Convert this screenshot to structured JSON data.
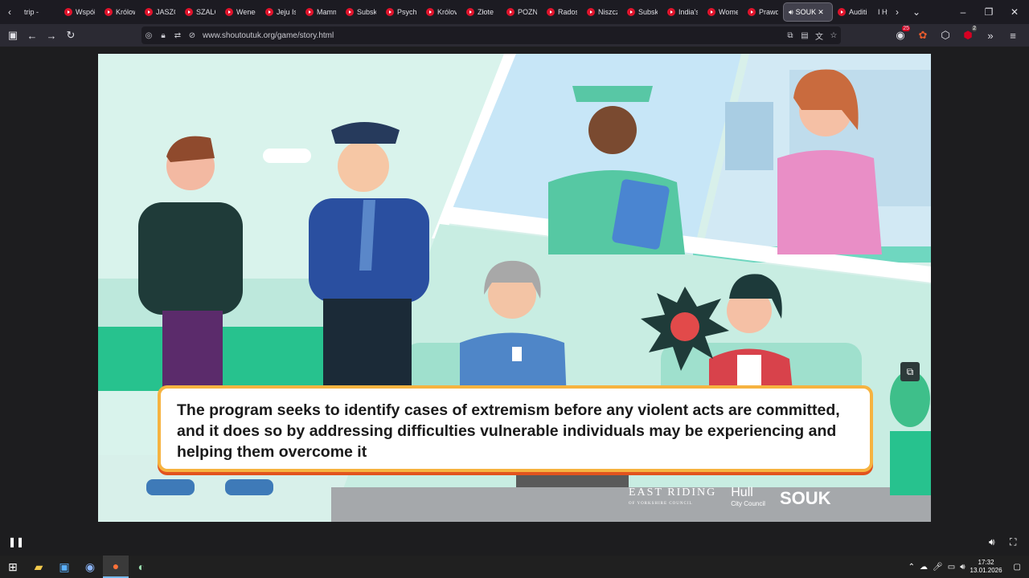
{
  "browser": {
    "tabs": [
      {
        "label": "trip - ",
        "fav": false
      },
      {
        "label": "Współ",
        "fav": true
      },
      {
        "label": "Królow",
        "fav": true
      },
      {
        "label": "JASZC",
        "fav": true
      },
      {
        "label": "SZALC",
        "fav": true
      },
      {
        "label": "Wenec",
        "fav": true
      },
      {
        "label": "Jeju Is",
        "fav": true
      },
      {
        "label": "Mamm",
        "fav": true
      },
      {
        "label": "Subsk",
        "fav": true
      },
      {
        "label": "Psych",
        "fav": true
      },
      {
        "label": "Królov",
        "fav": true
      },
      {
        "label": "Złote",
        "fav": true
      },
      {
        "label": "POZN",
        "fav": true
      },
      {
        "label": "Rados",
        "fav": true
      },
      {
        "label": "Niszcz",
        "fav": true
      },
      {
        "label": "Subsk",
        "fav": true
      },
      {
        "label": "India's",
        "fav": true
      },
      {
        "label": "Wome",
        "fav": true
      },
      {
        "label": "Prawd",
        "fav": true
      },
      {
        "label": "SOUK",
        "fav": false,
        "active": true
      },
      {
        "label": "Auditi",
        "fav": true
      },
      {
        "label": "I Hy",
        "fav": false
      }
    ],
    "url": "www.shoutoutuk.org/game/story.html",
    "badge_count": "25",
    "ext_count": "2"
  },
  "video": {
    "caption": "The program seeks to identify cases of extremism before any violent acts are committed, and it does so by addressing difficulties vulnerable individuals may be experiencing and helping them overcome it",
    "logo_east_riding": "EAST RIDING",
    "logo_east_riding_sub": "OF YORKSHIRE COUNCIL",
    "logo_hull": "Hull",
    "logo_hull_sub": "City Council",
    "logo_souk": "SOUK"
  },
  "taskbar": {
    "time": "17:32",
    "date": "13.01.2026"
  },
  "colors": {
    "accent_orange": "#f6b340",
    "accent_red": "#e2531e",
    "stage_bg": "#d8f0ea"
  }
}
